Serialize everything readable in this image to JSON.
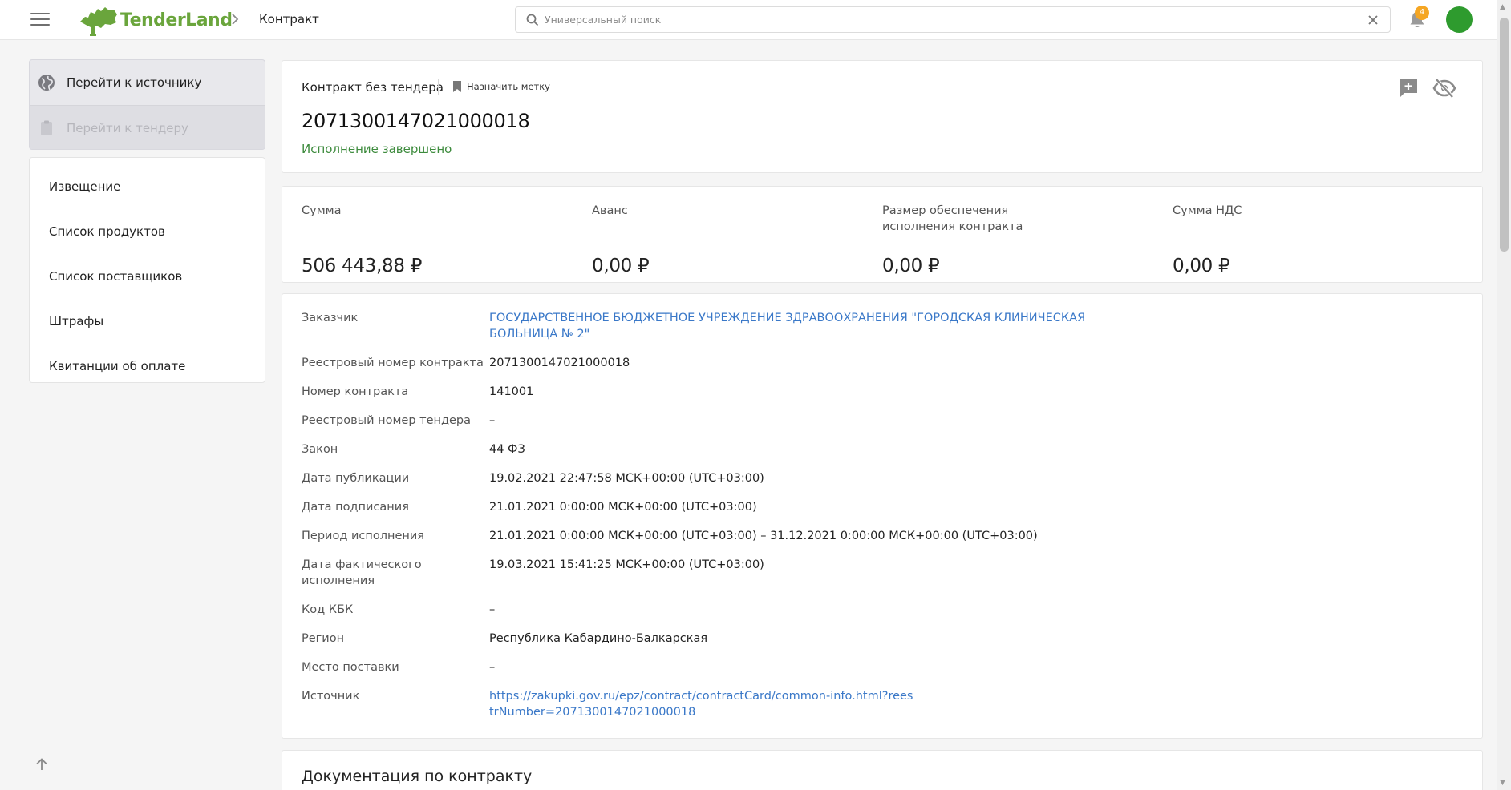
{
  "header": {
    "logo_text": "TenderLand",
    "breadcrumb_title": "Контракт",
    "search_placeholder": "Универсальный поиск",
    "notifications_count": "4"
  },
  "sidebar": {
    "source_actions": [
      {
        "label": "Перейти к источнику",
        "enabled": true
      },
      {
        "label": "Перейти к тендеру",
        "enabled": false
      }
    ],
    "items": [
      {
        "label": "Извещение"
      },
      {
        "label": "Список продуктов"
      },
      {
        "label": "Список поставщиков"
      },
      {
        "label": "Штрафы"
      },
      {
        "label": "Квитанции об оплате"
      }
    ]
  },
  "contract": {
    "kind": "Контракт без тендера",
    "tag_label": "Назначить метку",
    "number": "2071300147021000018",
    "status": "Исполнение завершено"
  },
  "money": [
    {
      "label": "Сумма",
      "value": "506 443,88 ₽"
    },
    {
      "label": "Аванс",
      "value": "0,00 ₽"
    },
    {
      "label": "Размер обеспечения исполнения контракта",
      "value": "0,00 ₽"
    },
    {
      "label": "Сумма НДС",
      "value": "0,00 ₽"
    }
  ],
  "details": [
    {
      "label": "Заказчик",
      "value": "ГОСУДАРСТВЕННОЕ БЮДЖЕТНОЕ УЧРЕЖДЕНИЕ ЗДРАВООХРАНЕНИЯ \"ГОРОДСКАЯ КЛИНИЧЕСКАЯ БОЛЬНИЦА № 2\"",
      "link": true
    },
    {
      "label": "Реестровый номер контракта",
      "value": "2071300147021000018"
    },
    {
      "label": "Номер контракта",
      "value": "141001"
    },
    {
      "label": "Реестровый номер тендера",
      "value": "–"
    },
    {
      "label": "Закон",
      "value": "44 ФЗ"
    },
    {
      "label": "Дата публикации",
      "value": "19.02.2021 22:47:58 МСК+00:00 (UTC+03:00)"
    },
    {
      "label": "Дата подписания",
      "value": "21.01.2021 0:00:00 МСК+00:00 (UTC+03:00)"
    },
    {
      "label": "Период исполнения",
      "value": "21.01.2021 0:00:00 МСК+00:00 (UTC+03:00) – 31.12.2021 0:00:00 МСК+00:00 (UTC+03:00)"
    },
    {
      "label": "Дата фактического исполнения",
      "value": "19.03.2021 15:41:25 МСК+00:00 (UTC+03:00)"
    },
    {
      "label": "Код КБК",
      "value": "–"
    },
    {
      "label": "Регион",
      "value": "Республика Кабардино-Балкарская"
    },
    {
      "label": "Место поставки",
      "value": "–"
    },
    {
      "label": "Источник",
      "value": "https://zakupki.gov.ru/epz/contract/contractCard/common-info.html?reestrNumber=2071300147021000018",
      "link": true
    }
  ],
  "documents": {
    "title": "Документация по контракту"
  },
  "colors": {
    "brand_green": "#6aa53c",
    "status_green": "#3d8b3d",
    "link_blue": "#3a78c8",
    "badge_orange": "#f5a623"
  }
}
